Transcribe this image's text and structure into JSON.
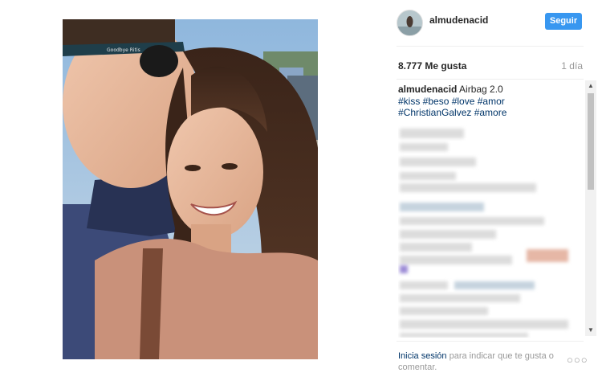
{
  "header": {
    "username": "almudenacid",
    "follow_label": "Seguir"
  },
  "stats": {
    "likes": "8.777 Me gusta",
    "time_ago": "1 día"
  },
  "caption": {
    "username": "almudenacid",
    "text": "Airbag 2.0",
    "hashtags_line1": "#kiss #beso #love #amor",
    "hashtags_line2": "#ChristianGalvez #amore"
  },
  "image": {
    "glasses_text": "Goodbye Ritis"
  },
  "footer": {
    "login_link": "Inicia sesión",
    "login_text": " para indicar que te gusta o comentar.",
    "more_label": "○○○"
  },
  "colors": {
    "accent": "#3897f0",
    "hashtag": "#003569",
    "muted": "#999999"
  }
}
